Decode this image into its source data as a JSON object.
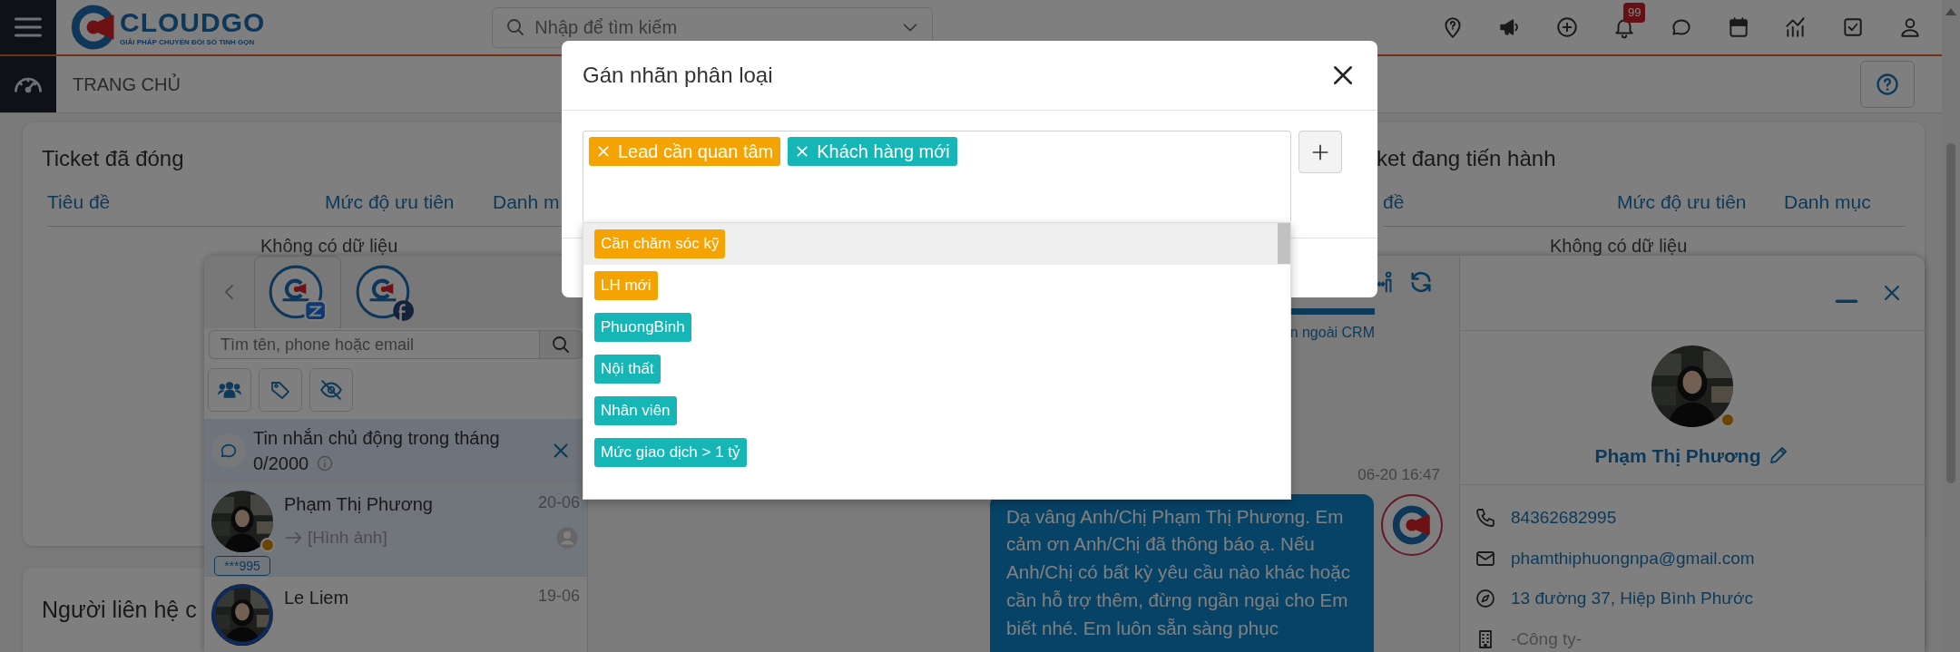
{
  "topbar": {
    "logo_name": "CLOUDGO",
    "logo_tagline": "GIẢI PHÁP CHUYỂN ĐỔI SỐ TINH GỌN",
    "search_placeholder": "Nhập để tìm kiếm",
    "notification_count": "99"
  },
  "page": {
    "title": "TRANG CHỦ"
  },
  "cards": [
    {
      "title": "Ticket đã đóng",
      "columns": [
        "Tiêu đề",
        "Mức độ ưu tiên",
        "Danh m"
      ],
      "empty_text": "Không có dữ liệu"
    },
    {
      "title": "ket đang tiến hành",
      "columns": [
        "đề",
        "Mức độ ưu tiên",
        "Danh mục"
      ],
      "empty_text": "Không có dữ liệu"
    },
    {
      "title": "Người liên hệ c"
    }
  ],
  "chat": {
    "accounts": [
      {
        "kind": "zalo",
        "selected": true
      },
      {
        "kind": "facebook",
        "selected": false
      }
    ],
    "search_placeholder": "Tìm tên, phone hoặc email",
    "notice": {
      "text": "Tin nhắn chủ động trong tháng",
      "count": "0/2000"
    },
    "conversations": [
      {
        "name": "Phạm Thị Phương",
        "date": "20-06",
        "preview": "[Hình ảnh]",
        "tag": "***995",
        "selected": true
      },
      {
        "name": "Le Liem",
        "date": "19-06",
        "selected": false
      }
    ],
    "thread": {
      "tab_text": "n ngoài CRM",
      "messages": [
        {
          "time": "06-20 16:47",
          "text": "Dạ vâng Anh/Chị Phạm Thị Phương. Em cảm ơn Anh/Chị đã thông báo ạ. Nếu Anh/Chị có bất kỳ yêu cầu nào khác hoặc cần hỗ trợ thêm, đừng ngần ngại cho Em biết nhé. Em luôn sẵn sàng phục"
        }
      ]
    },
    "contact": {
      "name": "Phạm Thị Phương",
      "phone": "84362682995",
      "email": "phamthiphuongnpa@gmail.com",
      "address": "13 đường 37, Hiệp Bình Phước",
      "company_placeholder": "-Công ty-"
    }
  },
  "modal": {
    "title": "Gán nhãn phân loại",
    "selected_tags": [
      {
        "label": "Lead cần quan tâm",
        "color": "#f5a302"
      },
      {
        "label": "Khách hàng mới",
        "color": "#17b6b6"
      }
    ],
    "options": [
      {
        "label": "Cần chăm sóc kỹ",
        "color": "#f5a302",
        "highlighted": true
      },
      {
        "label": "LH mới",
        "color": "#f5a302",
        "highlighted": false
      },
      {
        "label": "PhuongBinh",
        "color": "#17b6b6",
        "highlighted": false
      },
      {
        "label": "Nội thất",
        "color": "#17b6b6",
        "highlighted": false
      },
      {
        "label": "Nhân viên",
        "color": "#17b6b6",
        "highlighted": false
      },
      {
        "label": "Mức giao dịch > 1 tỷ",
        "color": "#17b6b6",
        "highlighted": false
      }
    ]
  }
}
